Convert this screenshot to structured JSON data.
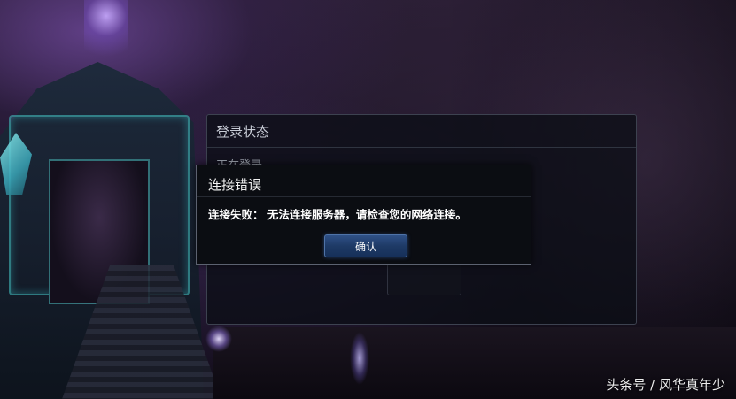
{
  "login_status_panel": {
    "title": "登录状态",
    "status_text": "正在登录……"
  },
  "error_dialog": {
    "title": "连接错误",
    "message": "连接失败： 无法连接服务器，请检查您的网络连接。",
    "confirm_label": "确认"
  },
  "watermark": "头条号 / 风华真年少",
  "colors": {
    "dialog_bg": "#0b0d12",
    "dialog_border": "#5c6270",
    "button_blue": "#1e3a66",
    "temple_glow": "#46c8c8"
  }
}
